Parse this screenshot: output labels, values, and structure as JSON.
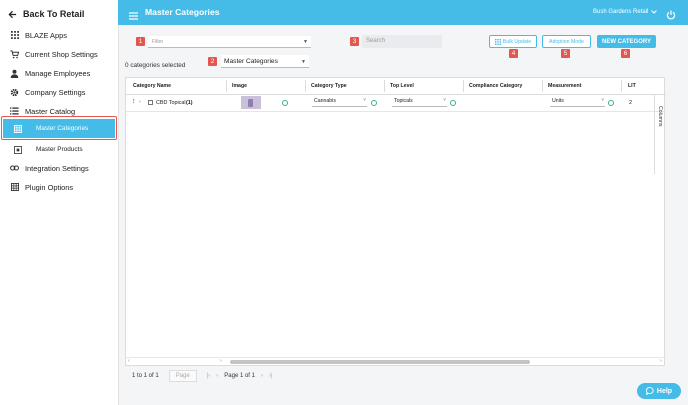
{
  "sidebar": {
    "back_label": "Back To Retail",
    "items": [
      {
        "label": "BLAZE Apps"
      },
      {
        "label": "Current Shop Settings"
      },
      {
        "label": "Manage Employees"
      },
      {
        "label": "Company Settings"
      },
      {
        "label": "Master Catalog"
      }
    ],
    "sub_items": [
      {
        "label": "Master Categories",
        "active": true
      },
      {
        "label": "Master Products"
      }
    ],
    "bottom_items": [
      {
        "label": "Integration Settings"
      },
      {
        "label": "Plugin Options"
      }
    ]
  },
  "header": {
    "title": "Master Categories",
    "store": "Bush Gardens Retail"
  },
  "toolbar": {
    "filter_placeholder": "Filter",
    "search_placeholder": "Search",
    "bulk_update": "Bulk Update",
    "adoption_mode": "Adoption Mode",
    "new_category": "NEW CATEGORY",
    "category_select": "Master Categories",
    "selected_count": "0 categories selected"
  },
  "annotations": [
    "1",
    "2",
    "3",
    "4",
    "5",
    "6"
  ],
  "grid": {
    "columns": [
      "Category Name",
      "Image",
      "Category Type",
      "Top Level",
      "Compliance Category",
      "Measurement",
      "LIT"
    ],
    "columns_tab": "Columns",
    "rows": [
      {
        "name": "CBD Topical",
        "count": "(1)",
        "type": "Cannabis",
        "top_level": "Topicals",
        "compliance": "",
        "measurement": "Units",
        "lit": "2"
      }
    ]
  },
  "pagination": {
    "range": "1 to 1 of 1",
    "page_button": "Page",
    "page_label": "Page 1 of 1"
  },
  "help": "Help",
  "colors": {
    "accent": "#45bce8",
    "annotation": "#e4574f",
    "ok": "#3ab27a"
  }
}
